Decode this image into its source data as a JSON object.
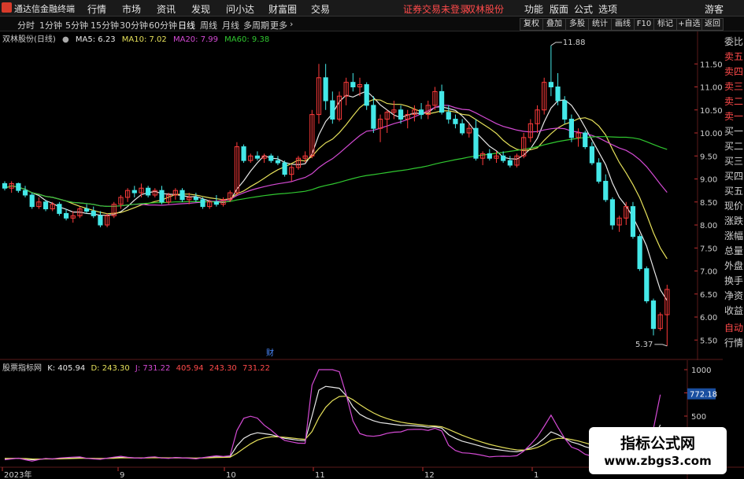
{
  "menubar": {
    "app_title": "通达信金融终端",
    "items": [
      "行情",
      "市场",
      "资讯",
      "发现",
      "问小达",
      "财富圈",
      "交易"
    ],
    "notice": "证券交易未登录",
    "stock_name": "双林股份",
    "right_items": [
      "功能",
      "版面",
      "公式",
      "选项",
      "游客"
    ]
  },
  "toolbar": {
    "periods": [
      "分时",
      "1分钟",
      "5分钟",
      "15分钟",
      "30分钟",
      "60分钟",
      "日线",
      "周线",
      "月线",
      "多周期",
      "更多"
    ],
    "active_period": "日线",
    "buttons": [
      "复权",
      "叠加",
      "多股",
      "统计",
      "画线",
      "F10",
      "标记",
      "+自选",
      "返回"
    ]
  },
  "main_legend": {
    "title": "双林股份(日线)",
    "ma5": "MA5: 6.23",
    "ma10": "MA10: 7.02",
    "ma20": "MA20: 7.99",
    "ma60": "MA60: 9.38"
  },
  "indicator_legend": {
    "title": "股票指标网",
    "k": "K: 405.94",
    "d": "D: 243.30",
    "j": "J: 731.22",
    "k2": "405.94",
    "d2": "243.30",
    "j2": "731.22"
  },
  "side_panel": [
    "委比",
    "卖五",
    "卖四",
    "卖三",
    "卖二",
    "卖一",
    "买一",
    "买二",
    "买三",
    "买四",
    "买五",
    "现价",
    "涨跌",
    "涨幅",
    "总量",
    "外盘",
    "换手",
    "净资",
    "收益",
    "自动",
    "行情"
  ],
  "annotations": {
    "high_label": "11.88",
    "low_label": "5.37",
    "event_marker": "财",
    "j_current": "772.18"
  },
  "time_labels": [
    "2023年",
    "9",
    "10",
    "11",
    "12",
    "1"
  ],
  "watermark": {
    "line1": "指标公式网",
    "line2": "www.zbgs3.com"
  },
  "colors": {
    "up": "#ff3b3b",
    "down": "#44e8e8",
    "ma5": "#e8e8e8",
    "ma10": "#e5e05a",
    "ma20": "#d44ad4",
    "ma60": "#30c830",
    "k": "#e8e8e8",
    "d": "#e5e05a",
    "j": "#d44ad4"
  },
  "chart_data": [
    {
      "type": "candlestick",
      "title": "双林股份(日线)",
      "ylim": [
        5.3,
        12.0
      ],
      "y_ticks": [
        "11.50",
        "11.00",
        "10.50",
        "10.00",
        "9.50",
        "9.00",
        "8.50",
        "8.00",
        "7.50",
        "7.00",
        "6.50",
        "6.00",
        "5.50"
      ],
      "ohlc": [
        [
          8.9,
          8.95,
          8.75,
          8.8
        ],
        [
          8.8,
          8.95,
          8.7,
          8.9
        ],
        [
          8.9,
          8.92,
          8.7,
          8.75
        ],
        [
          8.75,
          8.85,
          8.6,
          8.65
        ],
        [
          8.65,
          8.7,
          8.35,
          8.4
        ],
        [
          8.4,
          8.6,
          8.35,
          8.5
        ],
        [
          8.5,
          8.55,
          8.3,
          8.35
        ],
        [
          8.35,
          8.5,
          8.3,
          8.45
        ],
        [
          8.45,
          8.5,
          8.2,
          8.25
        ],
        [
          8.25,
          8.35,
          8.1,
          8.15
        ],
        [
          8.15,
          8.3,
          8.05,
          8.2
        ],
        [
          8.2,
          8.4,
          8.15,
          8.35
        ],
        [
          8.35,
          8.45,
          8.25,
          8.3
        ],
        [
          8.3,
          8.4,
          8.15,
          8.2
        ],
        [
          8.2,
          8.3,
          7.95,
          8.0
        ],
        [
          8.0,
          8.25,
          7.95,
          8.2
        ],
        [
          8.2,
          8.5,
          8.15,
          8.45
        ],
        [
          8.45,
          8.65,
          8.35,
          8.6
        ],
        [
          8.6,
          8.8,
          8.5,
          8.75
        ],
        [
          8.75,
          8.85,
          8.6,
          8.7
        ],
        [
          8.7,
          8.9,
          8.6,
          8.8
        ],
        [
          8.8,
          8.85,
          8.6,
          8.65
        ],
        [
          8.65,
          8.8,
          8.6,
          8.75
        ],
        [
          8.75,
          8.85,
          8.45,
          8.5
        ],
        [
          8.5,
          8.7,
          8.45,
          8.65
        ],
        [
          8.65,
          8.8,
          8.55,
          8.75
        ],
        [
          8.75,
          8.8,
          8.5,
          8.55
        ],
        [
          8.55,
          8.7,
          8.45,
          8.6
        ],
        [
          8.6,
          8.7,
          8.5,
          8.55
        ],
        [
          8.55,
          8.6,
          8.35,
          8.4
        ],
        [
          8.4,
          8.55,
          8.35,
          8.5
        ],
        [
          8.5,
          8.65,
          8.4,
          8.45
        ],
        [
          8.45,
          8.6,
          8.4,
          8.55
        ],
        [
          8.55,
          8.75,
          8.5,
          8.7
        ],
        [
          8.7,
          9.8,
          8.65,
          9.7
        ],
        [
          9.7,
          9.75,
          9.35,
          9.4
        ],
        [
          9.4,
          9.55,
          9.35,
          9.5
        ],
        [
          9.5,
          9.6,
          9.4,
          9.45
        ],
        [
          9.45,
          9.55,
          9.35,
          9.5
        ],
        [
          9.5,
          9.55,
          9.35,
          9.4
        ],
        [
          9.4,
          9.5,
          9.3,
          9.35
        ],
        [
          9.35,
          9.4,
          9.05,
          9.1
        ],
        [
          9.1,
          9.3,
          8.95,
          9.25
        ],
        [
          9.25,
          9.5,
          9.2,
          9.45
        ],
        [
          9.45,
          9.6,
          9.35,
          9.5
        ],
        [
          9.5,
          10.5,
          9.45,
          10.4
        ],
        [
          10.4,
          11.5,
          10.2,
          11.2
        ],
        [
          11.2,
          11.5,
          10.5,
          10.7
        ],
        [
          10.7,
          10.9,
          10.2,
          10.3
        ],
        [
          10.3,
          10.9,
          10.25,
          10.8
        ],
        [
          10.8,
          11.2,
          10.6,
          11.1
        ],
        [
          11.1,
          11.3,
          10.9,
          11.0
        ],
        [
          11.0,
          11.2,
          10.8,
          11.05
        ],
        [
          11.05,
          11.1,
          10.5,
          10.6
        ],
        [
          10.6,
          10.8,
          10.0,
          10.1
        ],
        [
          10.1,
          10.4,
          9.8,
          10.3
        ],
        [
          10.3,
          10.5,
          10.0,
          10.45
        ],
        [
          10.45,
          10.7,
          10.3,
          10.5
        ],
        [
          10.5,
          10.6,
          10.2,
          10.3
        ],
        [
          10.3,
          10.5,
          10.1,
          10.4
        ],
        [
          10.4,
          10.6,
          10.25,
          10.5
        ],
        [
          10.5,
          10.65,
          10.3,
          10.4
        ],
        [
          10.4,
          10.7,
          10.3,
          10.6
        ],
        [
          10.6,
          11.0,
          10.5,
          10.9
        ],
        [
          10.9,
          11.05,
          10.4,
          10.45
        ],
        [
          10.45,
          10.6,
          10.2,
          10.3
        ],
        [
          10.3,
          10.4,
          10.1,
          10.2
        ],
        [
          10.2,
          10.3,
          9.95,
          10.0
        ],
        [
          10.0,
          10.2,
          9.9,
          10.1
        ],
        [
          10.1,
          10.3,
          9.4,
          9.45
        ],
        [
          9.45,
          9.6,
          9.3,
          9.55
        ],
        [
          9.55,
          9.65,
          9.4,
          9.45
        ],
        [
          9.45,
          9.6,
          9.35,
          9.5
        ],
        [
          9.5,
          9.6,
          9.35,
          9.4
        ],
        [
          9.4,
          9.5,
          9.25,
          9.3
        ],
        [
          9.3,
          9.55,
          9.25,
          9.5
        ],
        [
          9.5,
          10.0,
          9.45,
          9.9
        ],
        [
          9.9,
          10.3,
          9.8,
          10.2
        ],
        [
          10.2,
          10.6,
          10.0,
          10.5
        ],
        [
          10.5,
          11.2,
          10.4,
          11.1
        ],
        [
          11.1,
          11.9,
          10.8,
          11.0
        ],
        [
          11.0,
          11.3,
          10.6,
          10.7
        ],
        [
          10.7,
          10.8,
          10.2,
          10.3
        ],
        [
          10.3,
          10.4,
          9.8,
          9.9
        ],
        [
          9.9,
          10.1,
          9.7,
          10.0
        ],
        [
          10.0,
          10.05,
          9.65,
          9.7
        ],
        [
          9.7,
          9.8,
          9.3,
          9.35
        ],
        [
          9.35,
          9.45,
          8.9,
          8.95
        ],
        [
          8.95,
          9.1,
          8.5,
          8.55
        ],
        [
          8.55,
          8.6,
          7.9,
          8.0
        ],
        [
          8.0,
          8.2,
          7.85,
          8.15
        ],
        [
          8.15,
          8.5,
          8.0,
          8.4
        ],
        [
          8.4,
          8.5,
          7.7,
          7.75
        ],
        [
          7.75,
          7.8,
          7.0,
          7.05
        ],
        [
          7.05,
          7.1,
          6.3,
          6.35
        ],
        [
          6.35,
          6.4,
          5.6,
          5.75
        ],
        [
          5.75,
          6.1,
          5.7,
          6.05
        ],
        [
          6.05,
          6.7,
          5.37,
          6.6
        ]
      ],
      "series": [
        {
          "name": "MA5"
        },
        {
          "name": "MA10"
        },
        {
          "name": "MA20"
        },
        {
          "name": "MA60"
        }
      ]
    },
    {
      "type": "line",
      "title": "股票指标网",
      "ylim": [
        0,
        1000
      ],
      "y_ticks": [
        "1000",
        "750",
        "500",
        "250"
      ],
      "series": [
        {
          "name": "K",
          "values": [
            40,
            42,
            45,
            38,
            30,
            35,
            40,
            38,
            42,
            45,
            48,
            50,
            45,
            42,
            40,
            45,
            50,
            55,
            52,
            50,
            48,
            52,
            55,
            50,
            48,
            52,
            50,
            48,
            45,
            50,
            55,
            60,
            58,
            62,
            180,
            260,
            300,
            320,
            310,
            300,
            280,
            260,
            250,
            240,
            235,
            500,
            780,
            820,
            810,
            800,
            720,
            600,
            520,
            480,
            450,
            430,
            420,
            410,
            400,
            400,
            395,
            390,
            380,
            385,
            370,
            300,
            260,
            230,
            210,
            190,
            170,
            150,
            140,
            130,
            120,
            115,
            130,
            160,
            200,
            260,
            330,
            300,
            260,
            220,
            200,
            170,
            150,
            130,
            110,
            100,
            110,
            130,
            150,
            170,
            200,
            250,
            405.94
          ]
        },
        {
          "name": "D",
          "values": [
            45,
            44,
            44,
            42,
            38,
            37,
            38,
            38,
            39,
            41,
            43,
            45,
            45,
            44,
            43,
            44,
            46,
            49,
            50,
            50,
            49,
            50,
            52,
            51,
            50,
            51,
            50,
            49,
            48,
            49,
            51,
            54,
            55,
            57,
            98,
            152,
            201,
            241,
            264,
            276,
            277,
            271,
            264,
            256,
            249,
            333,
            482,
            595,
            667,
            711,
            714,
            676,
            624,
            576,
            534,
            499,
            473,
            452,
            435,
            423,
            414,
            406,
            397,
            393,
            385,
            357,
            325,
            293,
            265,
            240,
            217,
            195,
            177,
            161,
            147,
            136,
            134,
            143,
            162,
            195,
            240,
            260,
            260,
            247,
            231,
            211,
            191,
            171,
            151,
            134,
            126,
            127,
            135,
            147,
            165,
            193,
            243.3
          ]
        },
        {
          "name": "J",
          "values": [
            30,
            38,
            47,
            30,
            14,
            31,
            44,
            38,
            48,
            53,
            58,
            60,
            45,
            38,
            34,
            47,
            58,
            67,
            56,
            50,
            46,
            56,
            61,
            48,
            44,
            54,
            50,
            46,
            39,
            52,
            63,
            72,
            64,
            72,
            344,
            476,
            498,
            478,
            402,
            348,
            286,
            238,
            222,
            208,
            207,
            834,
            1376,
            1270,
            1096,
            978,
            732,
            448,
            312,
            288,
            282,
            292,
            314,
            326,
            330,
            354,
            357,
            358,
            346,
            369,
            340,
            186,
            130,
            104,
            100,
            90,
            76,
            60,
            66,
            68,
            66,
            73,
            122,
            194,
            276,
            390,
            510,
            380,
            260,
            166,
            138,
            88,
            68,
            48,
            28,
            32,
            78,
            136,
            180,
            216,
            270,
            364,
            731.22
          ]
        }
      ]
    }
  ]
}
